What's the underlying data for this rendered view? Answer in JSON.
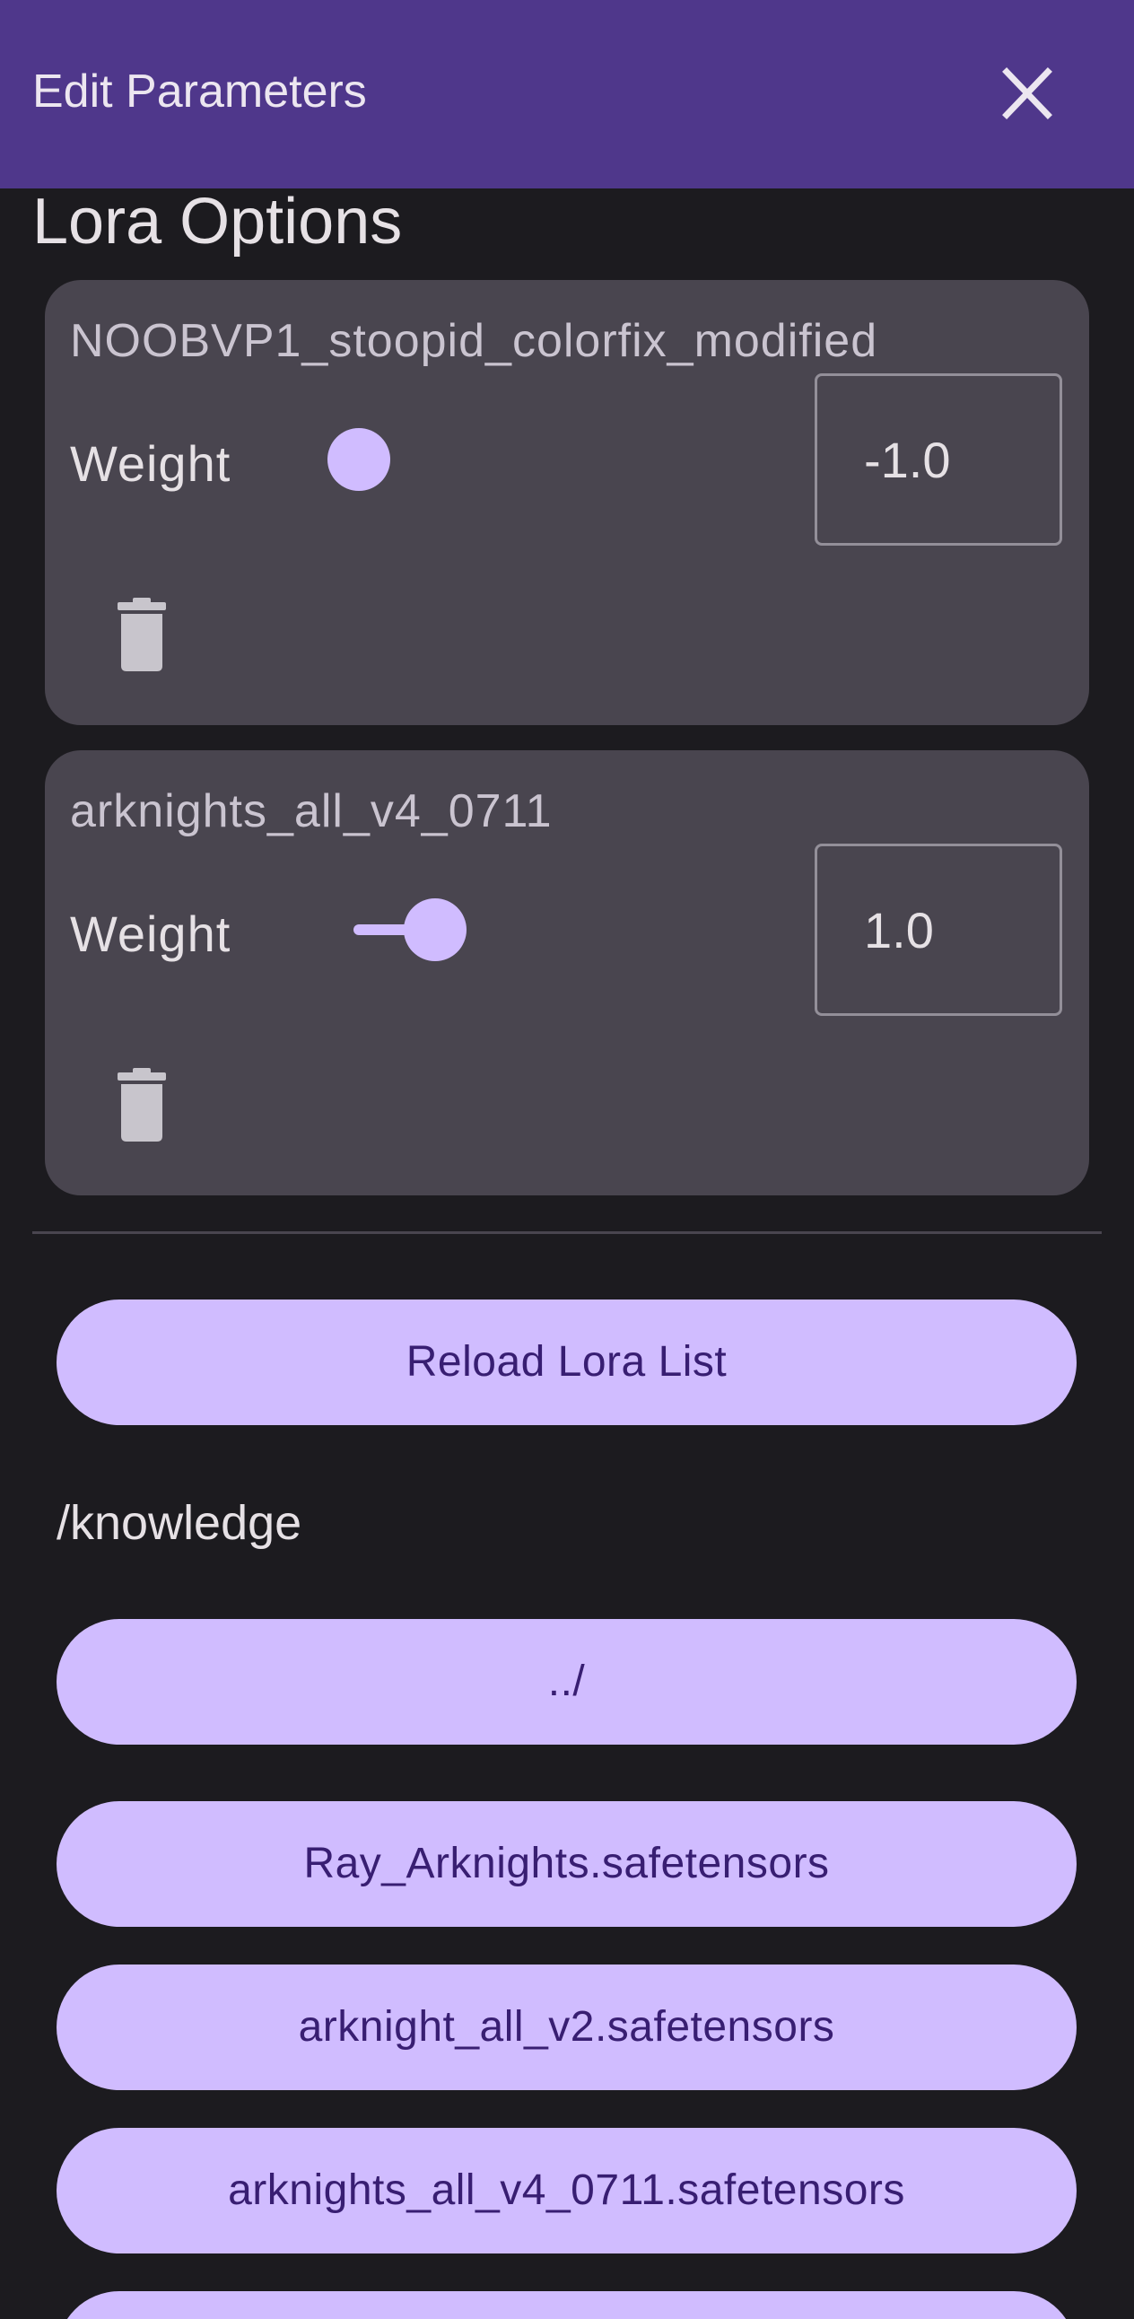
{
  "header": {
    "title": "Edit Parameters",
    "close_icon": "close-icon"
  },
  "section": {
    "title": "Lora Options"
  },
  "loras": [
    {
      "name": "NOOBVP1_stoopid_colorfix_modified",
      "weight_label": "Weight",
      "weight_value": "-1.0",
      "slider_level": -1.0,
      "delete_icon": "trash-icon"
    },
    {
      "name": "arknights_all_v4_0711",
      "weight_label": "Weight",
      "weight_value": "1.0",
      "slider_level": 1.0,
      "delete_icon": "trash-icon"
    }
  ],
  "reload_button": {
    "label": "Reload Lora List"
  },
  "browser": {
    "path": "/knowledge",
    "entries": [
      "../",
      "Ray_Arknights.safetensors",
      "arknight_all_v2.safetensors",
      "arknights_all_v4_0711.safetensors",
      ""
    ]
  },
  "colors": {
    "app_bar": "#4f378b",
    "background": "#1c1b1f",
    "card": "#49454f",
    "accent": "#d0bcff",
    "accent_text": "#381e72"
  }
}
